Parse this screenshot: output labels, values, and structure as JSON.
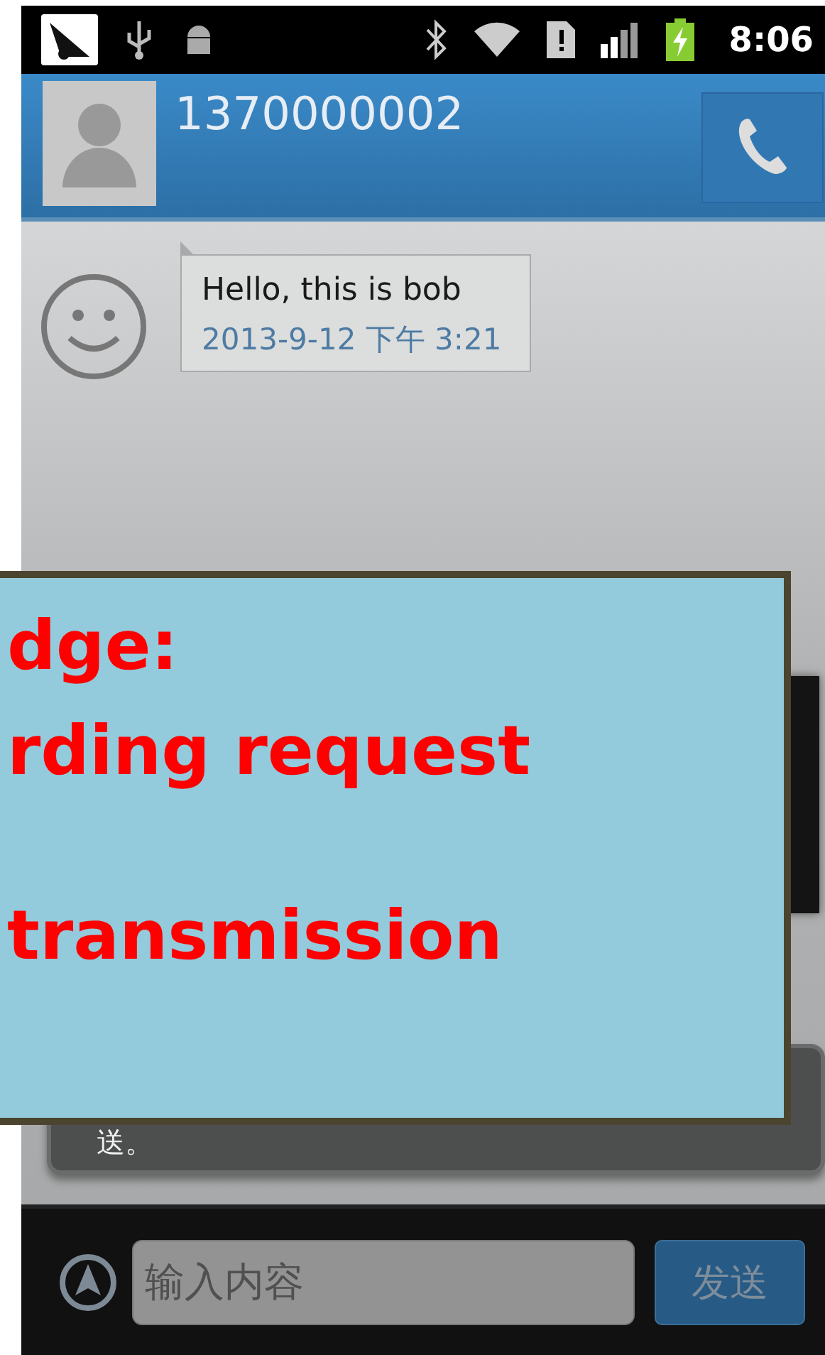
{
  "status_bar": {
    "time": "8:06"
  },
  "header": {
    "contact": "1370000002"
  },
  "messages": [
    {
      "text": "Hello, this is bob",
      "time": "2013-9-12 下午 3:21"
    }
  ],
  "toast": {
    "text": "送。"
  },
  "callout": {
    "lines": [
      "dge:",
      "rding request",
      "transmission"
    ]
  },
  "composer": {
    "placeholder": "输入内容",
    "send": "发送"
  }
}
